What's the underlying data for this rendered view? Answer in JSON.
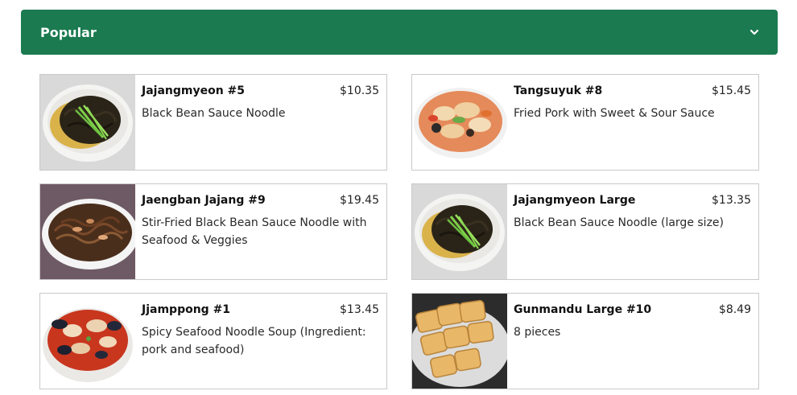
{
  "section": {
    "title": "Popular",
    "icon": "chevron-down-icon",
    "color": "#1b7a50"
  },
  "items": [
    {
      "name": "Jajangmyeon #5",
      "price": "$10.35",
      "description": "Black Bean Sauce Noodle",
      "image": "jajangmyeon-bowl"
    },
    {
      "name": "Tangsuyuk #8",
      "price": "$15.45",
      "description": "Fried Pork with Sweet & Sour Sauce",
      "image": "tangsuyuk-plate"
    },
    {
      "name": "Jaengban Jajang #9",
      "price": "$19.45",
      "description": "Stir-Fried Black Bean Sauce Noodle with Seafood & Veggies",
      "image": "jaengban-plate"
    },
    {
      "name": "Jajangmyeon Large",
      "price": "$13.35",
      "description": "Black Bean Sauce Noodle (large size)",
      "image": "jajangmyeon-bowl"
    },
    {
      "name": "Jjamppong #1",
      "price": "$13.45",
      "description": "Spicy Seafood Noodle Soup (Ingredient: pork and seafood)",
      "image": "jjamppong-bowl"
    },
    {
      "name": "Gunmandu Large #10",
      "price": "$8.49",
      "description": "8 pieces",
      "image": "dumplings-plate"
    }
  ]
}
